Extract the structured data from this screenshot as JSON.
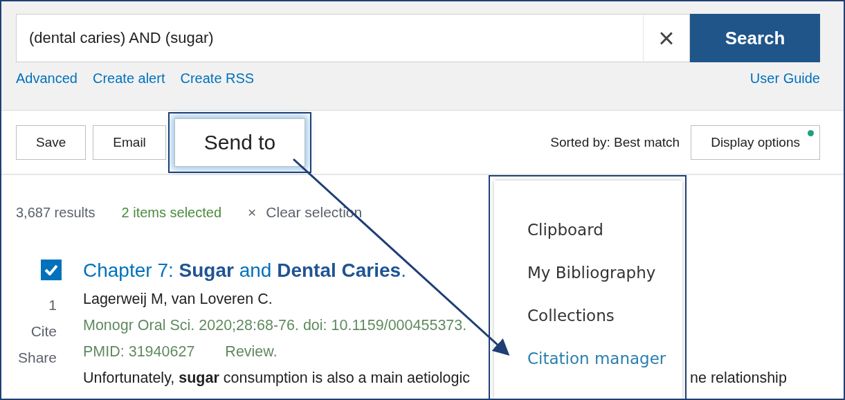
{
  "search": {
    "value": "(dental caries) AND (sugar)",
    "clear_icon": "×",
    "button": "Search"
  },
  "links": [
    "Advanced",
    "Create alert",
    "Create RSS"
  ],
  "user_guide": "User Guide",
  "actions": [
    {
      "label": "Save",
      "highlighted": false
    },
    {
      "label": "Email",
      "highlighted": false
    },
    {
      "label": "Send to",
      "highlighted": true
    }
  ],
  "sort": "Sorted by: Best match",
  "display_options": {
    "label": "Display options",
    "indicator": true
  },
  "summary": {
    "count": "3,687 results",
    "selected": "2 items selected",
    "clear_icon": "×",
    "clear": "Clear selection"
  },
  "results": [
    {
      "checked": true,
      "number": "1",
      "cite": "Cite",
      "share": "Share",
      "title": "Chapter 7: **Sugar** and **Dental Caries**.",
      "authors": "Lagerweij M, van Loveren C.",
      "citation": "Monogr Oral Sci. 2020;28:68-76. doi: 10.1159/000455373.",
      "pmid": "PMID: 31940627",
      "type": "Review.",
      "snippet": "Unfortunately, **sugar** consumption is also a main aetiologic",
      "snippet_tail": "ne relationship"
    }
  ],
  "menu": {
    "items": [
      {
        "label": "Clipboard",
        "selected": false
      },
      {
        "label": "My Bibliography",
        "selected": false
      },
      {
        "label": "Collections",
        "selected": false
      },
      {
        "label": "Citation manager",
        "selected": true
      }
    ]
  }
}
